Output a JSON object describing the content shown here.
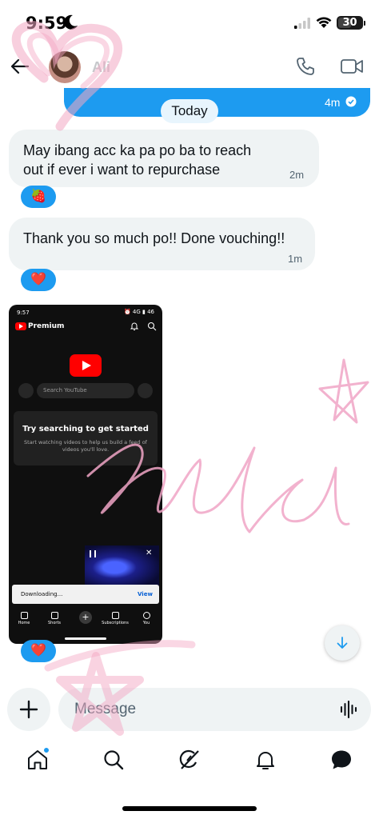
{
  "status_bar": {
    "time": "9:59",
    "battery": "30"
  },
  "header": {
    "contact_name": "Ali"
  },
  "sent_message": {
    "time": "4m"
  },
  "day_divider": "Today",
  "messages": [
    {
      "text": "May ibang acc ka pa po ba to reach out if ever i want to repurchase",
      "time": "2m",
      "reaction": "🍓"
    },
    {
      "text": "Thank you so much po!! Done vouching!!",
      "time": "1m",
      "reaction": "❤️"
    }
  ],
  "image_message": {
    "reaction": "❤️",
    "screenshot": {
      "status_time": "9:57",
      "status_right": "⏰ 4G ▮ 46",
      "brand": "Premium",
      "search_placeholder": "Search YouTube",
      "card_title": "Try searching to get started",
      "card_subtitle": "Start watching videos to help us build a feed of videos you'll love.",
      "toast_text": "Downloading...",
      "toast_action": "View",
      "nav": [
        "Home",
        "Shorts",
        "",
        "Subscriptions",
        "You"
      ]
    }
  },
  "composer": {
    "placeholder": "Message"
  },
  "colors": {
    "accent": "#1d9bf0",
    "bubble": "#eff3f4",
    "doodle": "#f2a9c7"
  },
  "icons": [
    "back-arrow-icon",
    "phone-icon",
    "video-camera-icon",
    "plus-icon",
    "voice-wave-icon",
    "home-icon",
    "search-icon",
    "grok-icon",
    "bell-icon",
    "messages-icon"
  ]
}
